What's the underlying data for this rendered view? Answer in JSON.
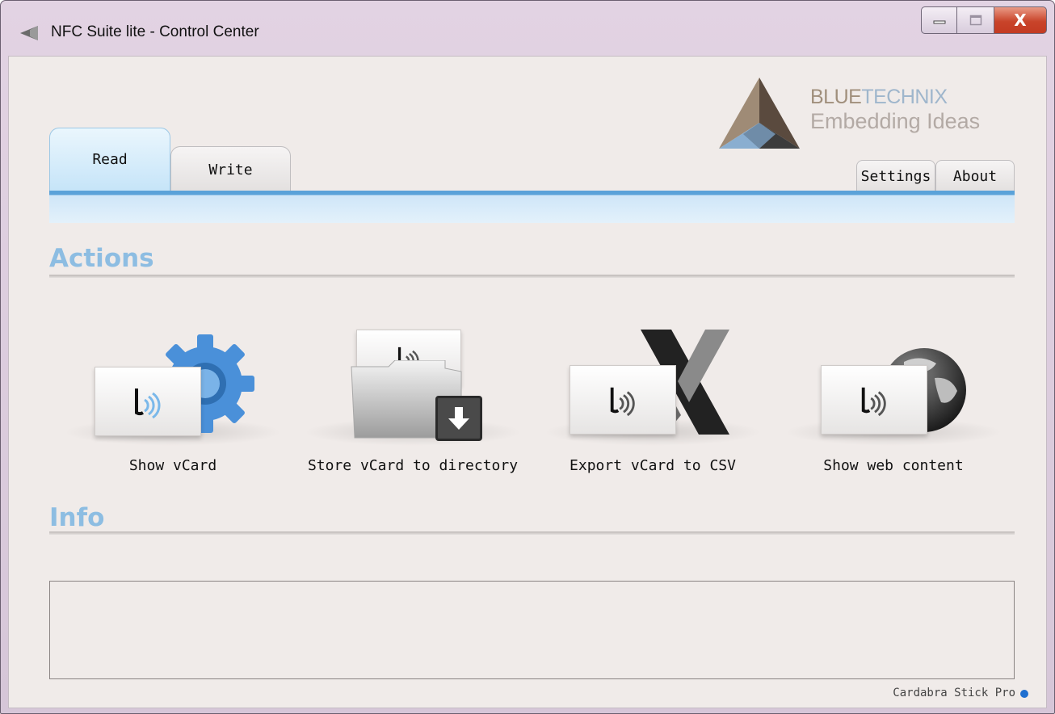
{
  "window": {
    "title": "NFC Suite lite - Control Center",
    "close_glyph": "X"
  },
  "logo": {
    "brand_part1": "BLUE",
    "brand_part2": "TECHNIX",
    "tagline": "Embedding Ideas"
  },
  "tabs": {
    "read": "Read",
    "write": "Write",
    "settings": "Settings",
    "about": "About"
  },
  "sections": {
    "actions": "Actions",
    "info": "Info"
  },
  "actions": [
    {
      "label": "Show vCard",
      "icon": "gear-icon"
    },
    {
      "label": "Store vCard to directory",
      "icon": "folder-download-icon"
    },
    {
      "label": "Export vCard to CSV",
      "icon": "excel-x-icon"
    },
    {
      "label": "Show web content",
      "icon": "globe-icon"
    }
  ],
  "status": {
    "device": "Cardabra Stick Pro"
  },
  "colors": {
    "accent_blue": "#5aa2d9",
    "section_title": "#8dbde2",
    "status_dot": "#1f6fd0",
    "close_red": "#c9442a"
  }
}
